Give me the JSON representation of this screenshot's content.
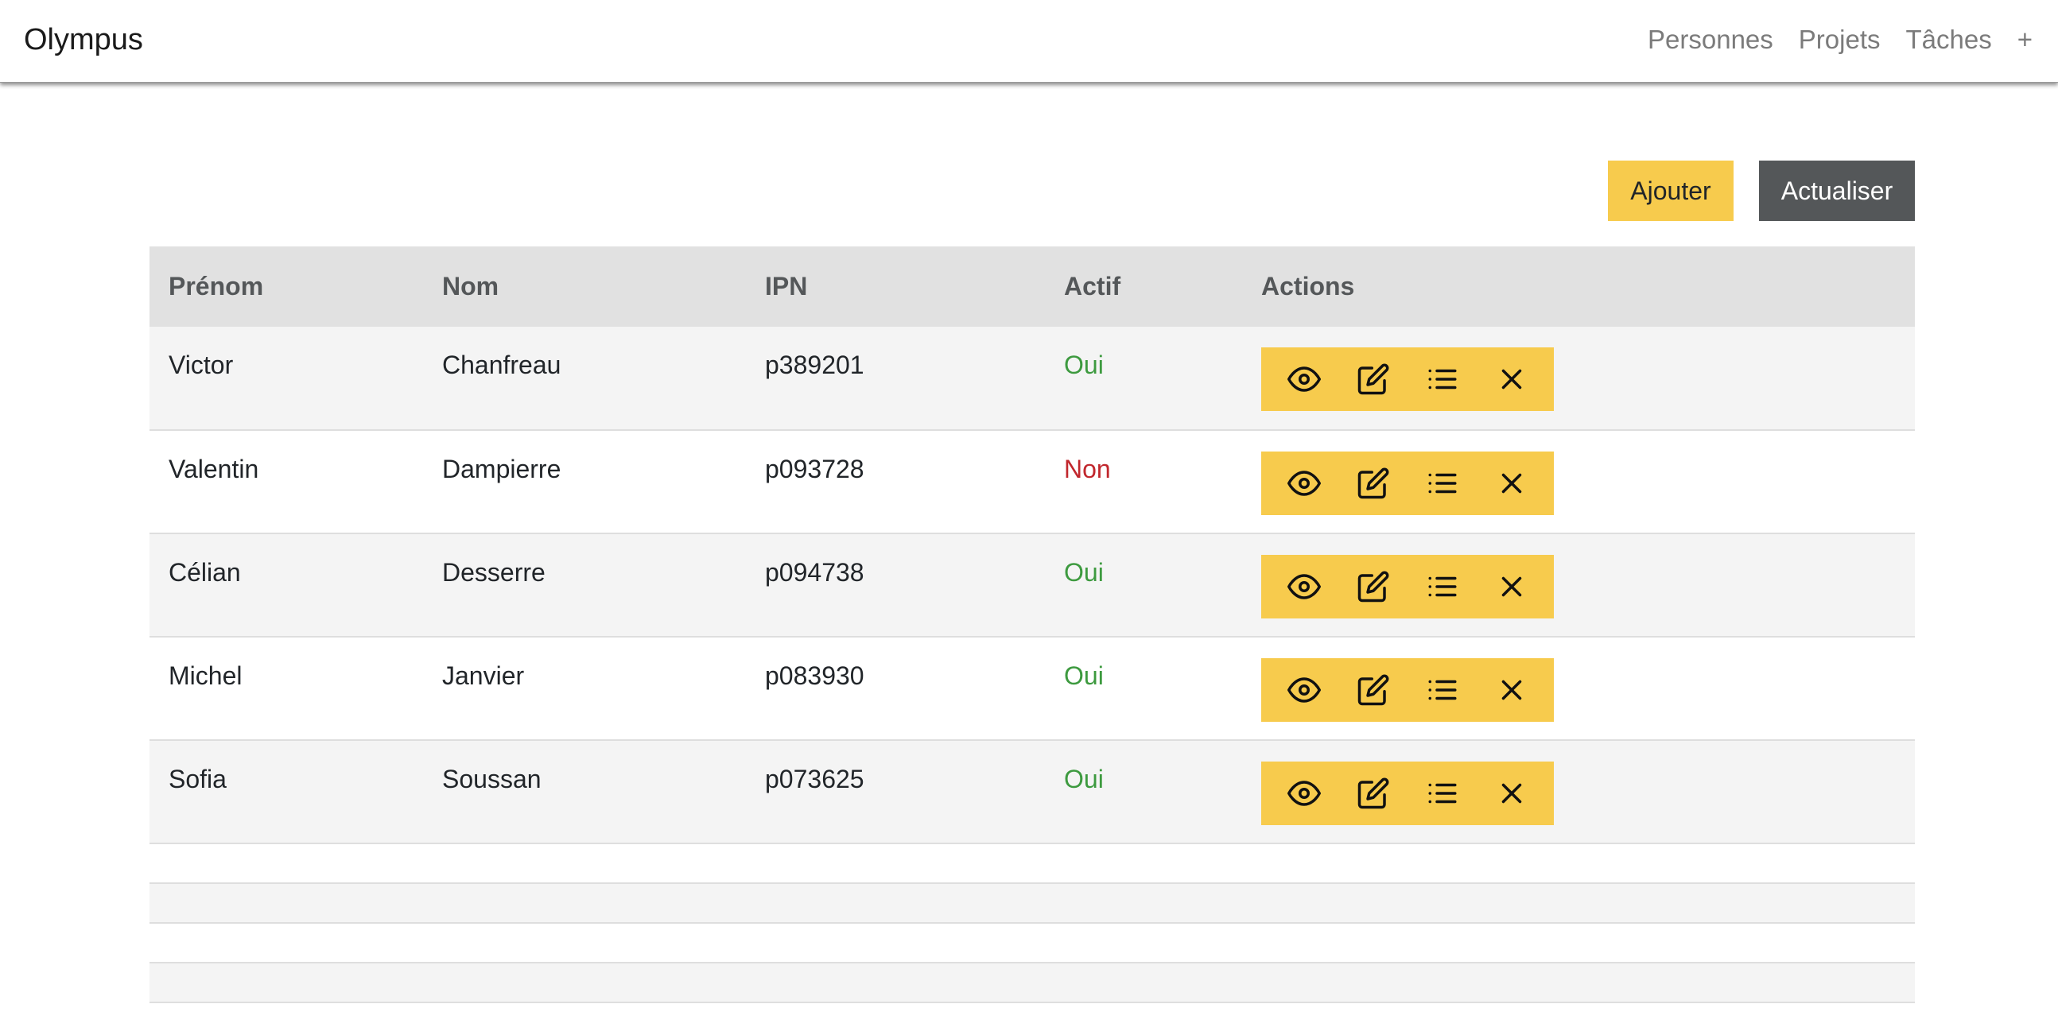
{
  "app": {
    "title": "Olympus"
  },
  "nav": {
    "items": [
      {
        "label": "Personnes"
      },
      {
        "label": "Projets"
      },
      {
        "label": "Tâches"
      },
      {
        "label": "+"
      }
    ]
  },
  "toolbar": {
    "add_label": "Ajouter",
    "refresh_label": "Actualiser"
  },
  "table": {
    "headers": {
      "first_name": "Prénom",
      "last_name": "Nom",
      "ipn": "IPN",
      "active": "Actif",
      "actions": "Actions"
    },
    "rows": [
      {
        "first_name": "Victor",
        "last_name": "Chanfreau",
        "ipn": "p389201",
        "active": "Oui"
      },
      {
        "first_name": "Valentin",
        "last_name": "Dampierre",
        "ipn": "p093728",
        "active": "Non"
      },
      {
        "first_name": "Célian",
        "last_name": "Desserre",
        "ipn": "p094738",
        "active": "Oui"
      },
      {
        "first_name": "Michel",
        "last_name": "Janvier",
        "ipn": "p083930",
        "active": "Oui"
      },
      {
        "first_name": "Sofia",
        "last_name": "Soussan",
        "ipn": "p073625",
        "active": "Oui"
      }
    ],
    "empty_rows": 4,
    "action_icons": [
      "eye-icon",
      "edit-icon",
      "list-icon",
      "close-icon"
    ]
  },
  "colors": {
    "accent_yellow": "#f7cb4d",
    "dark_button": "#545759",
    "status_yes": "#3d9a3f",
    "status_no": "#c1272d"
  }
}
